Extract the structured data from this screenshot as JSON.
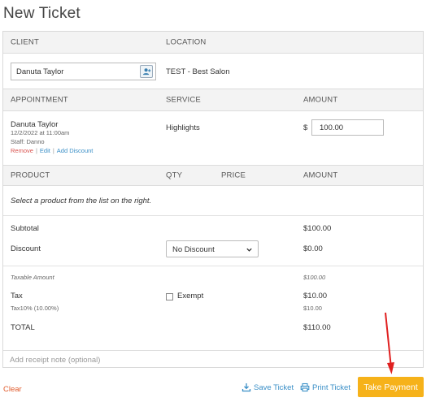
{
  "page": {
    "title": "New Ticket"
  },
  "client_section": {
    "headers": {
      "client": "CLIENT",
      "location": "LOCATION"
    },
    "client_value": "Danuta Taylor",
    "location_value": "TEST - Best Salon"
  },
  "appointment_section": {
    "headers": {
      "appointment": "APPOINTMENT",
      "service": "SERVICE",
      "amount": "AMOUNT"
    },
    "client_name": "Danuta Taylor",
    "datetime": "12/2/2022 at 11:00am",
    "staff": "Staff: Danno",
    "links": {
      "remove": "Remove",
      "edit": "Edit",
      "add_discount": "Add Discount"
    },
    "service": "Highlights",
    "currency": "$",
    "amount_value": "100.00"
  },
  "product_section": {
    "headers": {
      "product": "PRODUCT",
      "qty": "QTY",
      "price": "PRICE",
      "amount": "AMOUNT"
    },
    "empty_message": "Select a product from the list on the right."
  },
  "totals": {
    "subtotal_label": "Subtotal",
    "subtotal_value": "$100.00",
    "discount_label": "Discount",
    "discount_select": "No Discount",
    "discount_value": "$0.00",
    "taxable_label": "Taxable Amount",
    "taxable_value": "$100.00",
    "tax_label": "Tax",
    "tax_detail": "Tax10% (10.00%)",
    "exempt_label": "Exempt",
    "tax_value": "$10.00",
    "tax_detail_value": "$10.00",
    "total_label": "TOTAL",
    "total_value": "$110.00"
  },
  "note": {
    "placeholder": "Add receipt note (optional)"
  },
  "footer": {
    "clear": "Clear",
    "save": "Save Ticket",
    "print": "Print Ticket",
    "pay": "Take Payment"
  },
  "colors": {
    "accent": "#f6b21a",
    "link": "#3a8fc7",
    "danger": "#d9534f",
    "annotation_arrow": "#e02020"
  }
}
